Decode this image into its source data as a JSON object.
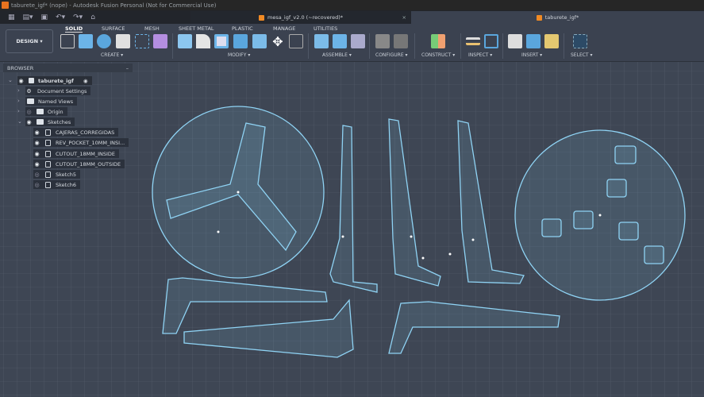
{
  "window": {
    "title": "taburete_igf* (nope) - Autodesk Fusion Personal (Not for Commercial Use)"
  },
  "tabs": [
    {
      "label": "mesa_igf_v2.0 (~recovered)*",
      "active": false
    },
    {
      "label": "taburete_igf*",
      "active": true
    }
  ],
  "workspace": {
    "label": "DESIGN ▾"
  },
  "toolbar_tabs": [
    "SOLID",
    "SURFACE",
    "MESH",
    "SHEET METAL",
    "PLASTIC",
    "MANAGE",
    "UTILITIES"
  ],
  "groups": [
    "CREATE ▾",
    "MODIFY ▾",
    "ASSEMBLE ▾",
    "CONFIGURE ▾",
    "CONSTRUCT ▾",
    "INSPECT ▾",
    "INSERT ▾",
    "SELECT ▾"
  ],
  "browser": {
    "title": "BROWSER",
    "root": "taburete_igf",
    "items": [
      "Document Settings",
      "Named Views",
      "Origin",
      "Sketches"
    ],
    "sketches": [
      "CAJERAS_CORREGIDAS",
      "REV_POCKET_10MM_INSI...",
      "CUTOUT_18MM_INSIDE",
      "CUTOUT_18MM_OUTSIDE",
      "Sketch5",
      "Sketch6"
    ]
  },
  "colors": {
    "sketch": "#8fd3f4",
    "background": "#3e4654",
    "accent": "#f08a24"
  }
}
